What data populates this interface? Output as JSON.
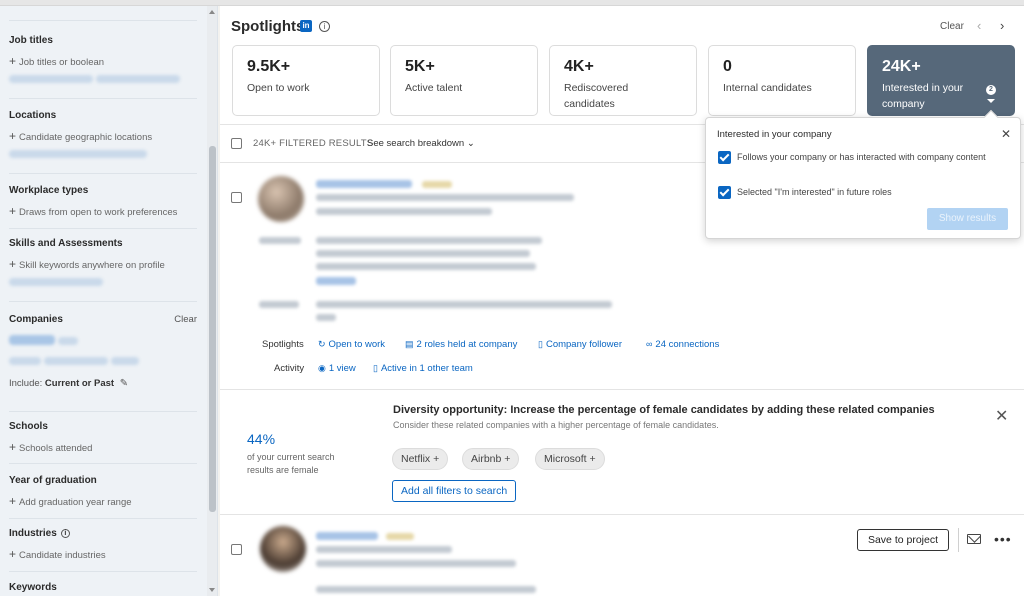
{
  "sidebar": {
    "sections": [
      {
        "title": "Job titles",
        "add": "Job titles or boolean"
      },
      {
        "title": "Locations",
        "add": "Candidate geographic locations"
      },
      {
        "title": "Workplace types",
        "add": "Draws from open to work preferences"
      },
      {
        "title": "Skills and Assessments",
        "add": "Skill keywords anywhere on profile"
      },
      {
        "title": "Companies",
        "clear": "Clear",
        "include_label": "Include:",
        "include_value": "Current or Past"
      },
      {
        "title": "Schools",
        "add": "Schools attended"
      },
      {
        "title": "Year of graduation",
        "add": "Add graduation year range"
      },
      {
        "title": "Industries",
        "add": "Candidate industries"
      },
      {
        "title": "Keywords"
      }
    ]
  },
  "header": {
    "title": "Spotlights",
    "li_icon": "in",
    "info_icon": "i",
    "clear": "Clear",
    "prev": "‹",
    "next": "›"
  },
  "spotlight_cards": [
    {
      "value": "9.5K+",
      "label": "Open to work"
    },
    {
      "value": "5K+",
      "label": "Active talent"
    },
    {
      "value": "4K+",
      "label": "Rediscovered candidates"
    },
    {
      "value": "0",
      "label": "Internal candidates"
    },
    {
      "value": "24K+",
      "label": "Interested in your company",
      "badge": "2",
      "active": true
    }
  ],
  "results_bar": {
    "filtered": "24K+ FILTERED RESULTS",
    "breakdown": "See search breakdown"
  },
  "candidate": {
    "spotlights_label": "Spotlights",
    "spotlights": [
      {
        "icon": "↻",
        "text": "Open to work"
      },
      {
        "icon": "▤",
        "text": "2 roles held at company"
      },
      {
        "icon": "▯",
        "text": "Company follower"
      },
      {
        "icon": "∞",
        "text": "24 connections"
      }
    ],
    "activity_label": "Activity",
    "activity": [
      {
        "icon": "◉",
        "text": "1 view"
      },
      {
        "icon": "▯",
        "text": "Active in 1 other team"
      }
    ]
  },
  "diversity": {
    "pct": "44%",
    "pct_desc": "of your current search results are female",
    "title": "Diversity opportunity: Increase the percentage of female candidates by adding these related companies",
    "subtitle": "Consider these related companies with a higher percentage of female candidates.",
    "close": "✕",
    "companies": [
      "Netflix +",
      "Airbnb +",
      "Microsoft +"
    ],
    "add_all": "Add all filters to search"
  },
  "candidate2": {
    "save": "Save to project",
    "more": "•••"
  },
  "popup": {
    "title": "Interested in your company",
    "close": "✕",
    "options": [
      {
        "label": "Follows your company or has interacted with company content",
        "checked": true
      },
      {
        "label": "Selected \"I'm interested\" in future roles",
        "checked": true
      }
    ],
    "show_results": "Show results"
  },
  "colors": {
    "accent": "#0a66c2",
    "active_card": "#56687a"
  }
}
